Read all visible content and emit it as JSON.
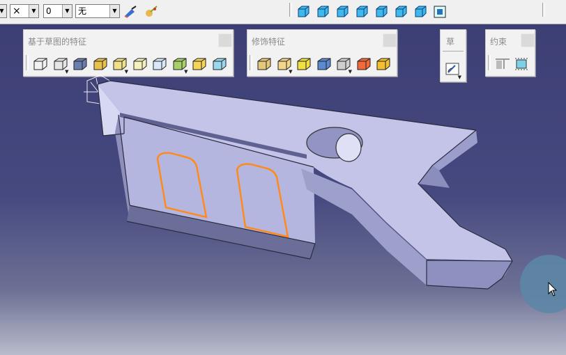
{
  "top_toolbar": {
    "combo_blank": "",
    "combo_x": "×",
    "combo_layer": "0",
    "combo_wu": "无",
    "view_icons": [
      "iso-view-icon",
      "front-view-icon",
      "back-view-icon",
      "left-view-icon",
      "right-view-icon",
      "top-view-icon",
      "bottom-view-icon",
      "named-views-icon"
    ]
  },
  "sketch_features_toolbar": {
    "title": "基于草图的特征",
    "icons": [
      "pad-icon",
      "pocket-icon",
      "shaft-icon",
      "groove-icon",
      "hole-icon",
      "rib-icon",
      "slot-icon",
      "stiffener-icon",
      "multi-section-solid-icon",
      "removed-multi-section-icon"
    ]
  },
  "dressup_features_toolbar": {
    "title": "修饰特征",
    "icons": [
      "edge-fillet-icon",
      "chamfer-icon",
      "draft-icon",
      "shell-icon",
      "thickness-icon",
      "thread-icon",
      "remove-face-icon"
    ]
  },
  "sketcher_toolbar": {
    "title": "草",
    "icons": [
      "sketch-icon"
    ]
  },
  "constraints_toolbar": {
    "title": "约束",
    "icons": [
      "constraint-icon",
      "anchor-icon"
    ]
  },
  "colors": {
    "background_top": "#3b3d73",
    "part_top_face": "#c6c7ea",
    "part_side_face": "#8f91bd",
    "highlight_edge": "#ff8a1c",
    "cursor_halo": "#5d86a6"
  }
}
